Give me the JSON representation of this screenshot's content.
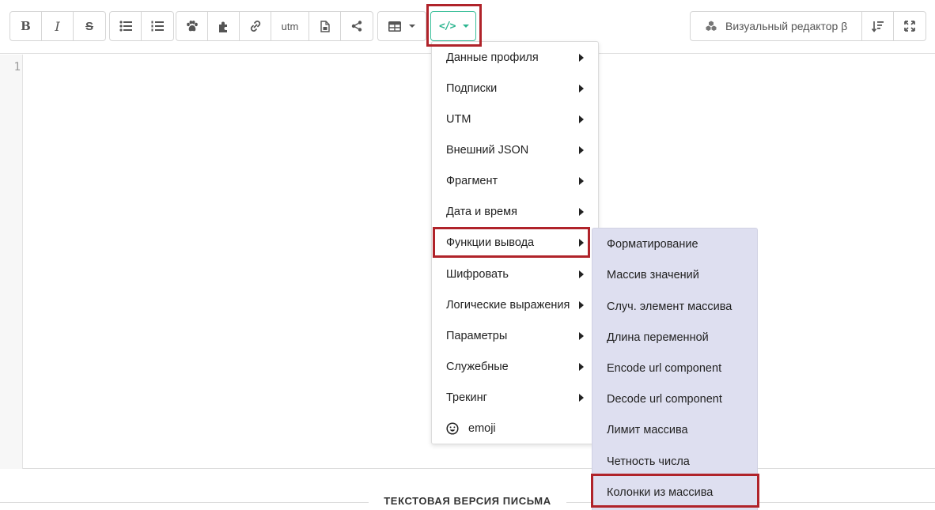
{
  "toolbar": {
    "text_format": [
      "bold-icon",
      "italic-icon",
      "strikethrough-icon"
    ],
    "lists": [
      "bullet-list-icon",
      "numbered-list-icon"
    ],
    "insert": [
      "paw-icon",
      "puzzle-icon",
      "link-icon",
      "utm",
      "file-icon",
      "share-icon"
    ],
    "utm_label": "utm",
    "table_icon": "table-icon",
    "code_icon": "code-icon",
    "visual_editor_label": "Визуальный редактор β",
    "sort_icon": "sort-icon",
    "fullscreen_icon": "fullscreen-icon",
    "accent_color": "#2bb58f"
  },
  "editor": {
    "line_numbers": [
      "1"
    ]
  },
  "footer": {
    "title": "ТЕКСТОВАЯ ВЕРСИЯ ПИСЬМА"
  },
  "menu": {
    "items": [
      {
        "label": "Данные профиля",
        "has_submenu": true
      },
      {
        "label": "Подписки",
        "has_submenu": true
      },
      {
        "label": "UTM",
        "has_submenu": true
      },
      {
        "label": "Внешний JSON",
        "has_submenu": true
      },
      {
        "label": "Фрагмент",
        "has_submenu": true
      },
      {
        "label": "Дата и время",
        "has_submenu": true
      },
      {
        "label": "Функции вывода",
        "has_submenu": true,
        "active": true
      },
      {
        "label": "Шифровать",
        "has_submenu": true
      },
      {
        "label": "Логические выражения",
        "has_submenu": true
      },
      {
        "label": "Параметры",
        "has_submenu": true
      },
      {
        "label": "Служебные",
        "has_submenu": true
      },
      {
        "label": "Трекинг",
        "has_submenu": true
      },
      {
        "label": "emoji",
        "has_submenu": false,
        "icon": "smiley-icon"
      }
    ]
  },
  "submenu": {
    "background": "#dedff0",
    "items": [
      {
        "label": "Форматирование"
      },
      {
        "label": "Массив значений"
      },
      {
        "label": "Случ. элемент массива"
      },
      {
        "label": "Длина переменной"
      },
      {
        "label": "Encode url component"
      },
      {
        "label": "Decode url component"
      },
      {
        "label": "Лимит массива"
      },
      {
        "label": "Четность числа"
      },
      {
        "label": "Колонки из массива",
        "highlighted": true
      }
    ]
  },
  "highlight_color": "#b0232a"
}
